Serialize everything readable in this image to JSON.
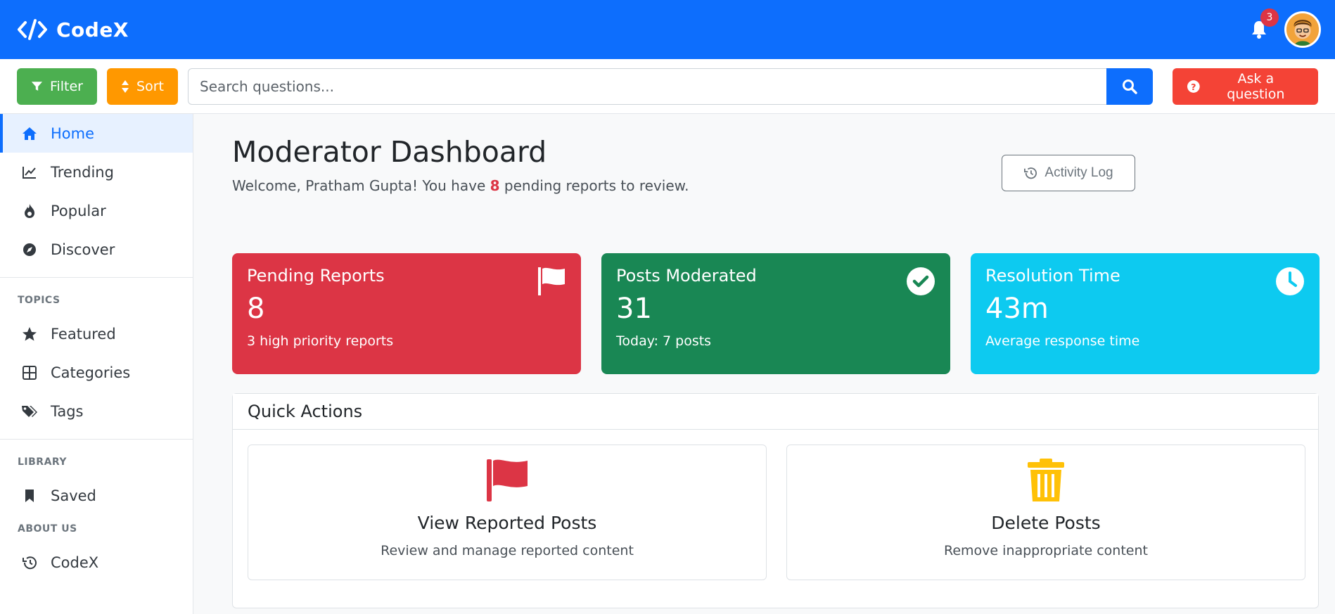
{
  "navbar": {
    "brand": "CodeX",
    "notification_count": "3"
  },
  "toolbar": {
    "filter_label": "Filter",
    "sort_label": "Sort",
    "search_placeholder": "Search questions...",
    "ask_label": "Ask a question"
  },
  "sidebar": {
    "items": [
      {
        "label": "Home",
        "icon": "home-icon"
      },
      {
        "label": "Trending",
        "icon": "trending-icon"
      },
      {
        "label": "Popular",
        "icon": "fire-icon"
      },
      {
        "label": "Discover",
        "icon": "compass-icon"
      }
    ],
    "topics_heading": "TOPICS",
    "topics": [
      {
        "label": "Featured",
        "icon": "star-icon"
      },
      {
        "label": "Categories",
        "icon": "grid-icon"
      },
      {
        "label": "Tags",
        "icon": "tags-icon"
      }
    ],
    "library_heading": "LIBRARY",
    "library": [
      {
        "label": "Saved",
        "icon": "bookmark-icon"
      }
    ],
    "about_heading": "ABOUT US",
    "about": [
      {
        "label": "CodeX",
        "icon": "history-icon"
      }
    ]
  },
  "main": {
    "title": "Moderator Dashboard",
    "welcome_prefix": "Welcome, Pratham Gupta! You have ",
    "pending_count": "8",
    "welcome_suffix": " pending reports to review.",
    "activity_log_label": "Activity Log",
    "stats": [
      {
        "title": "Pending Reports",
        "value": "8",
        "sub": "3 high priority reports",
        "icon": "flag-icon",
        "color": "#dc3545"
      },
      {
        "title": "Posts Moderated",
        "value": "31",
        "sub": "Today: 7 posts",
        "icon": "check-circle-icon",
        "color": "#198754"
      },
      {
        "title": "Resolution Time",
        "value": "43m",
        "sub": "Average response time",
        "icon": "clock-icon",
        "color": "#0dcaf0"
      }
    ],
    "quick_actions": {
      "title": "Quick Actions",
      "cards": [
        {
          "title": "View Reported Posts",
          "desc": "Review and manage reported content",
          "icon": "flag-icon",
          "color": "#dc3545"
        },
        {
          "title": "Delete Posts",
          "desc": "Remove inappropriate content",
          "icon": "trash-icon",
          "color": "#ffc107"
        }
      ]
    }
  }
}
